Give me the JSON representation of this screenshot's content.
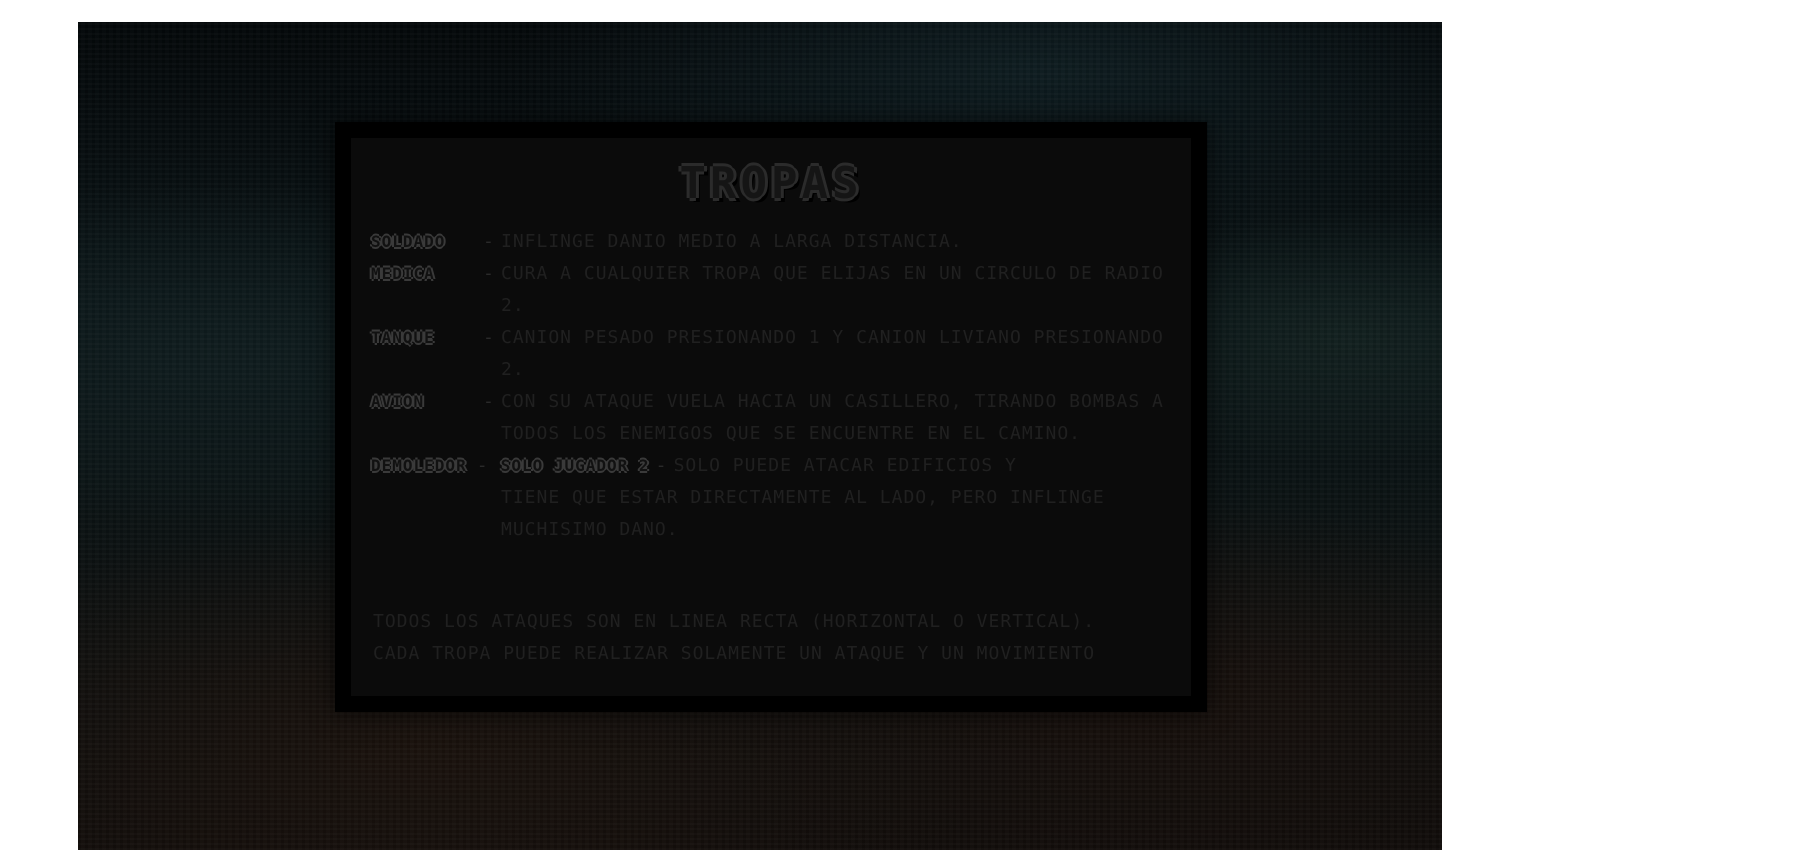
{
  "dialog": {
    "title": "TROPAS",
    "separator": "-",
    "troops": [
      {
        "name": "SOLDADO",
        "description": "INFLINGE DANIO MEDIO A LARGA DISTANCIA."
      },
      {
        "name": "MEDICA",
        "description": "CURA A CUALQUIER TROPA QUE ELIJAS EN UN CIRCULO DE RADIO 2."
      },
      {
        "name": "TANQUE",
        "description": "CANION PESADO PRESIONANDO 1 Y CANION LIVIANO PRESIONANDO 2."
      },
      {
        "name": "AVION",
        "description": "CON SU ATAQUE VUELA HACIA UN CASILLERO, TIRANDO BOMBAS A TODOS LOS ENEMIGOS QUE SE ENCUENTRE EN EL CAMINO."
      },
      {
        "name": "DEMOLEDOR",
        "player_note": "SOLO JUGADOR 2",
        "description_first": "SOLO PUEDE ATACAR EDIFICIOS Y",
        "description_rest": "TIENE QUE ESTAR DIRECTAMENTE AL LADO, PERO INFLINGE MUCHISIMO DANO."
      }
    ],
    "footer": [
      "TODOS LOS ATAQUES SON EN LINEA RECTA (HORIZONTAL O VERTICAL).",
      "CADA TROPA PUEDE REALIZAR SOLAMENTE UN ATAQUE Y UN MOVIMIENTO"
    ]
  }
}
